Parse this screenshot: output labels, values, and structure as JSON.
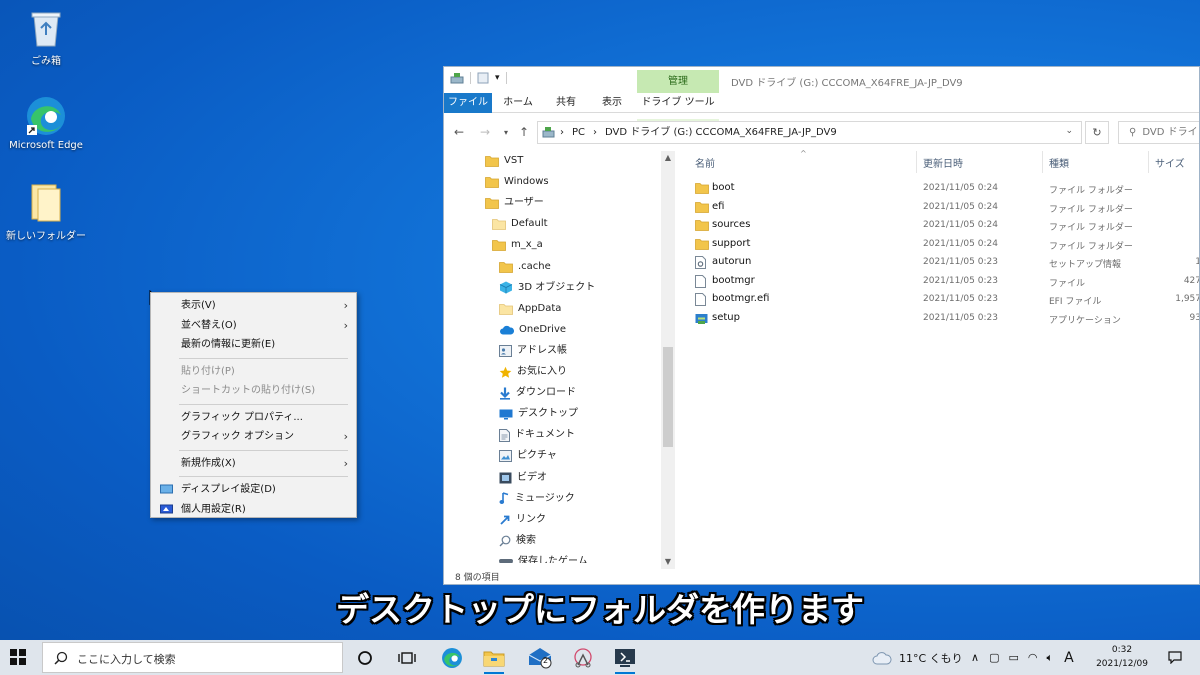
{
  "desktop": {
    "icons": [
      {
        "label": "ごみ箱"
      },
      {
        "label": "Microsoft Edge"
      },
      {
        "label": "新しいフォルダー"
      }
    ]
  },
  "context_menu": {
    "items": [
      {
        "label": "表示(V)",
        "submenu": true,
        "enabled": true
      },
      {
        "label": "並べ替え(O)",
        "submenu": true,
        "enabled": true
      },
      {
        "label": "最新の情報に更新(E)",
        "submenu": false,
        "enabled": true
      },
      {
        "label": "貼り付け(P)",
        "submenu": false,
        "enabled": false
      },
      {
        "label": "ショートカットの貼り付け(S)",
        "submenu": false,
        "enabled": false
      },
      {
        "label": "グラフィック プロパティ...",
        "submenu": false,
        "enabled": true
      },
      {
        "label": "グラフィック オプション",
        "submenu": true,
        "enabled": true
      },
      {
        "label": "新規作成(X)",
        "submenu": true,
        "enabled": true
      },
      {
        "label": "ディスプレイ設定(D)",
        "submenu": false,
        "enabled": true
      },
      {
        "label": "個人用設定(R)",
        "submenu": false,
        "enabled": true
      }
    ]
  },
  "explorer": {
    "title": "DVD ドライブ (G:) CCCOMA_X64FRE_JA-JP_DV9",
    "manage_tab": "管理",
    "tabs": {
      "file": "ファイル",
      "home": "ホーム",
      "share": "共有",
      "view": "表示",
      "drive_tools": "ドライブ ツール"
    },
    "address": {
      "crumbs": [
        "PC",
        "DVD ドライブ (G:) CCCOMA_X64FRE_JA-JP_DV9"
      ]
    },
    "search_placeholder": "DVD ドライ",
    "nav_items": [
      {
        "label": "VST",
        "icon": "folder-icon"
      },
      {
        "label": "Windows",
        "icon": "folder-icon"
      },
      {
        "label": "ユーザー",
        "icon": "folder-icon"
      },
      {
        "label": "Default",
        "icon": "folder-light-icon"
      },
      {
        "label": "m_x_a",
        "icon": "folder-icon"
      },
      {
        "label": ".cache",
        "icon": "folder-icon"
      },
      {
        "label": "3D オブジェクト",
        "icon": "cube-icon"
      },
      {
        "label": "AppData",
        "icon": "folder-light-icon"
      },
      {
        "label": "OneDrive",
        "icon": "cloud-icon"
      },
      {
        "label": "アドレス帳",
        "icon": "contacts-icon"
      },
      {
        "label": "お気に入り",
        "icon": "star-icon"
      },
      {
        "label": "ダウンロード",
        "icon": "download-icon"
      },
      {
        "label": "デスクトップ",
        "icon": "desktop-icon"
      },
      {
        "label": "ドキュメント",
        "icon": "document-icon"
      },
      {
        "label": "ピクチャ",
        "icon": "picture-icon"
      },
      {
        "label": "ビデオ",
        "icon": "video-icon"
      },
      {
        "label": "ミュージック",
        "icon": "music-icon"
      },
      {
        "label": "リンク",
        "icon": "link-icon"
      },
      {
        "label": "検索",
        "icon": "search-icon"
      },
      {
        "label": "保存したゲーム",
        "icon": "game-icon"
      }
    ],
    "columns": {
      "name": "名前",
      "date": "更新日時",
      "type": "種類",
      "size": "サイズ"
    },
    "files": [
      {
        "name": "boot",
        "date": "2021/11/05 0:24",
        "type": "ファイル フォルダー",
        "size": "",
        "icon": "folder-icon"
      },
      {
        "name": "efi",
        "date": "2021/11/05 0:24",
        "type": "ファイル フォルダー",
        "size": "",
        "icon": "folder-icon"
      },
      {
        "name": "sources",
        "date": "2021/11/05 0:24",
        "type": "ファイル フォルダー",
        "size": "",
        "icon": "folder-icon"
      },
      {
        "name": "support",
        "date": "2021/11/05 0:24",
        "type": "ファイル フォルダー",
        "size": "",
        "icon": "folder-icon"
      },
      {
        "name": "autorun",
        "date": "2021/11/05 0:23",
        "type": "セットアップ情報",
        "size": "1",
        "icon": "settings-file-icon"
      },
      {
        "name": "bootmgr",
        "date": "2021/11/05 0:23",
        "type": "ファイル",
        "size": "427",
        "icon": "file-icon"
      },
      {
        "name": "bootmgr.efi",
        "date": "2021/11/05 0:23",
        "type": "EFI ファイル",
        "size": "1,957",
        "icon": "file-icon"
      },
      {
        "name": "setup",
        "date": "2021/11/05 0:23",
        "type": "アプリケーション",
        "size": "93",
        "icon": "setup-icon"
      }
    ],
    "status": "8 個の項目"
  },
  "subtitle": "デスクトップにフォルダを作ります",
  "taskbar": {
    "search_placeholder": "ここに入力して検索",
    "mail_badge": "2",
    "weather": "11°C くもり",
    "ime": "A",
    "time": "0:32",
    "date": "2021/12/09"
  },
  "colors": {
    "accent": "#1979ca",
    "manage": "#c6e9b2",
    "folder": "#f2c54b"
  }
}
